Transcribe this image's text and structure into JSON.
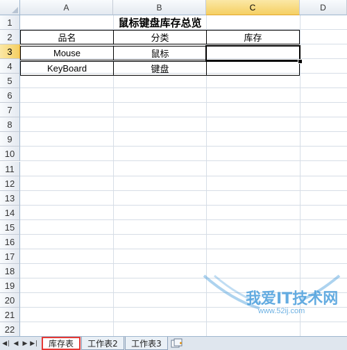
{
  "columns": [
    "A",
    "B",
    "C",
    "D"
  ],
  "rows": [
    "1",
    "2",
    "3",
    "4",
    "5",
    "6",
    "7",
    "8",
    "9",
    "10",
    "11",
    "12",
    "13",
    "14",
    "15",
    "16",
    "17",
    "18",
    "19",
    "20",
    "21",
    "22"
  ],
  "cells": {
    "title": "鼠标键盘库存总览",
    "header_name": "品名",
    "header_category": "分类",
    "header_stock": "库存",
    "r3_name": "Mouse",
    "r3_category": "鼠标",
    "r4_name": "KeyBoard",
    "r4_category": "键盘"
  },
  "selected_cell": "C3",
  "tabs": [
    {
      "label": "库存表",
      "active": true
    },
    {
      "label": "工作表2",
      "active": false
    },
    {
      "label": "工作表3",
      "active": false
    }
  ],
  "nav_icons": [
    "first-sheet-icon",
    "prev-sheet-icon",
    "next-sheet-icon",
    "last-sheet-icon"
  ],
  "watermark": {
    "text": "我爱IT技术网",
    "url": "www.52ij.com"
  },
  "colors": {
    "selection_header": "#f5cf62",
    "active_tab_border": "#e53935",
    "grid": "#d6dde6",
    "watermark": "#4a9edc"
  }
}
